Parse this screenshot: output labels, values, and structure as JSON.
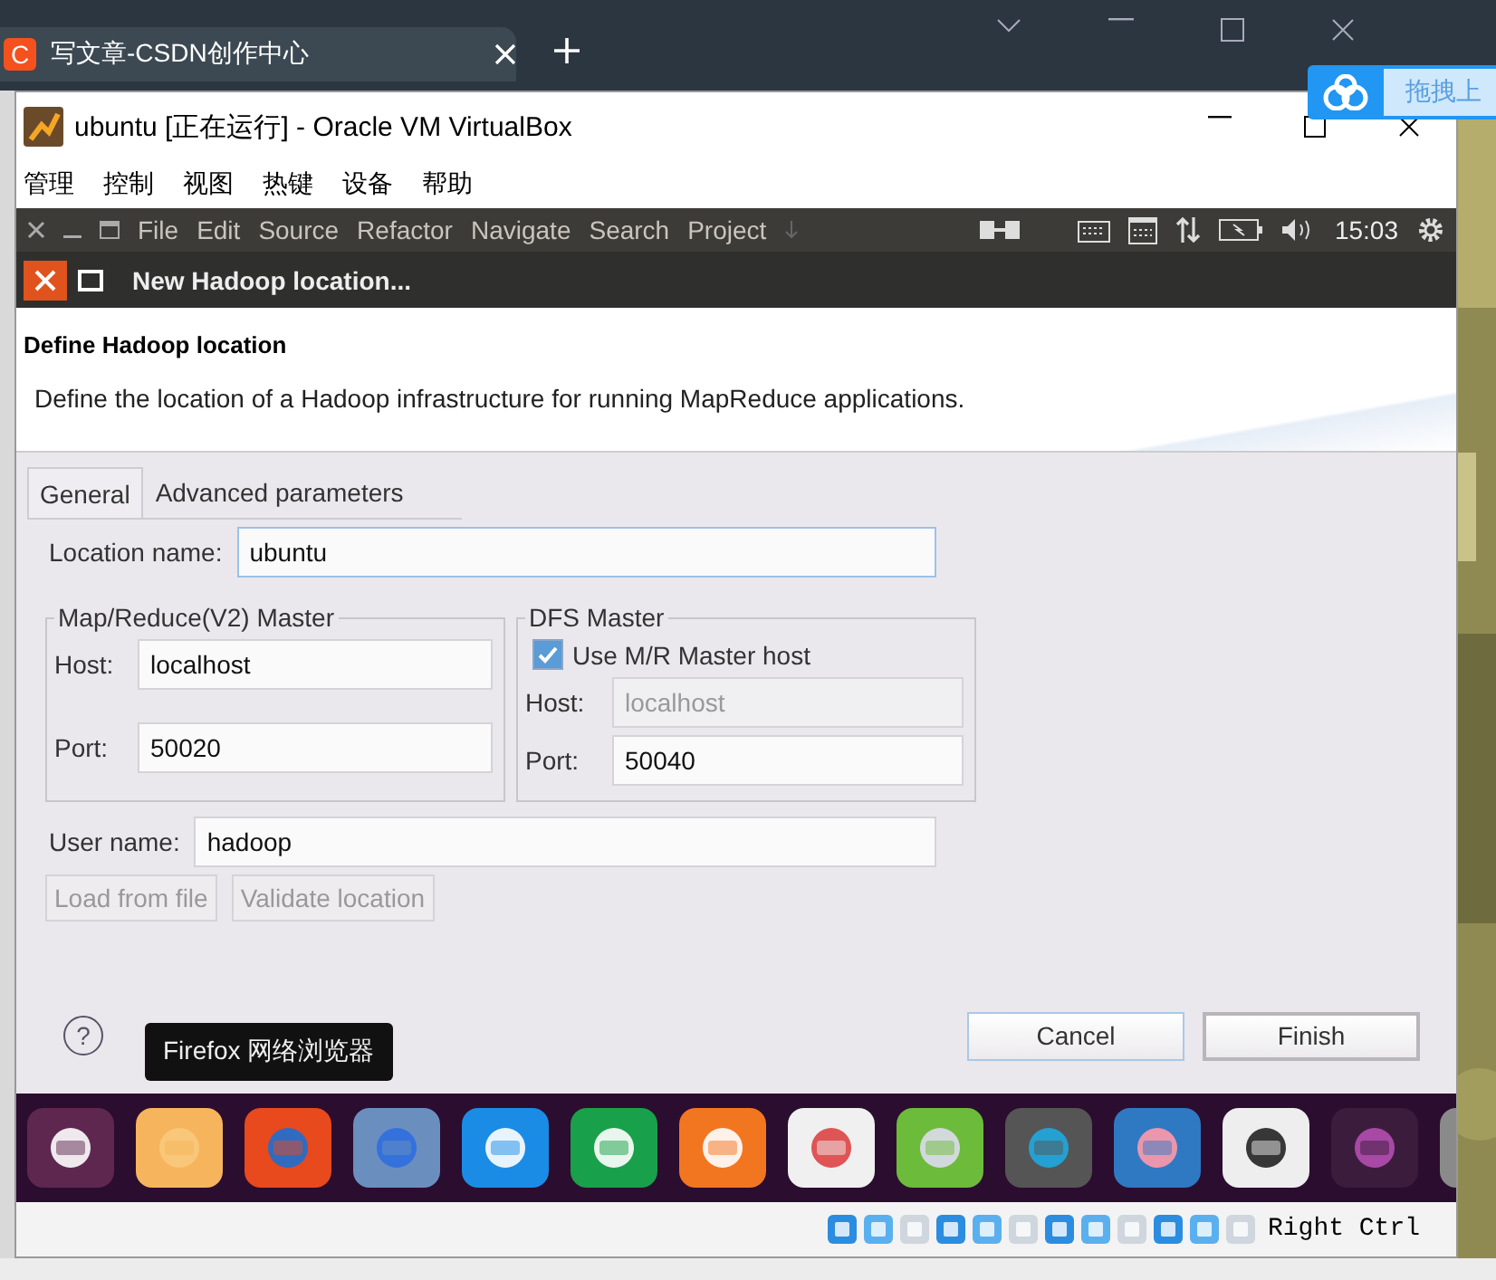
{
  "browser": {
    "tab_title": "写文章-CSDN创作中心",
    "tab_logo": "C"
  },
  "upload_widget": {
    "label": "拖拽上"
  },
  "vbox": {
    "title": "ubuntu [正在运行] - Oracle VM VirtualBox",
    "menu": [
      "管理",
      "控制",
      "视图",
      "热键",
      "设备",
      "帮助"
    ]
  },
  "panel": {
    "menus": [
      "File",
      "Edit",
      "Source",
      "Refactor",
      "Navigate",
      "Search",
      "Project"
    ],
    "clock": "15:03"
  },
  "dialog": {
    "title": "New Hadoop location...",
    "heading": "Define Hadoop location",
    "description": "Define the location of a Hadoop infrastructure for running MapReduce applications.",
    "tabs": [
      {
        "label": "General",
        "selected": true
      },
      {
        "label": "Advanced parameters",
        "selected": false
      }
    ],
    "location_name": {
      "label": "Location name:",
      "value": "ubuntu"
    },
    "mr_master": {
      "title": "Map/Reduce(V2) Master",
      "host": {
        "label": "Host:",
        "value": "localhost"
      },
      "port": {
        "label": "Port:",
        "value": "50020"
      }
    },
    "dfs_master": {
      "title": "DFS Master",
      "use_mr_host": {
        "label": "Use M/R Master host",
        "checked": true
      },
      "host": {
        "label": "Host:",
        "value": "localhost",
        "disabled": true
      },
      "port": {
        "label": "Port:",
        "value": "50040",
        "disabled": false
      }
    },
    "user_name": {
      "label": "User name:",
      "value": "hadoop"
    },
    "tool_buttons": [
      {
        "label": "Load from file",
        "disabled": true
      },
      {
        "label": "Validate location",
        "disabled": true
      }
    ],
    "help": "?",
    "buttons": [
      {
        "label": "Cancel",
        "default": false
      },
      {
        "label": "Finish",
        "default": true
      }
    ]
  },
  "tooltip": {
    "text": "Firefox 网络浏览器"
  },
  "status_bar": {
    "host_key": "Right Ctrl"
  }
}
